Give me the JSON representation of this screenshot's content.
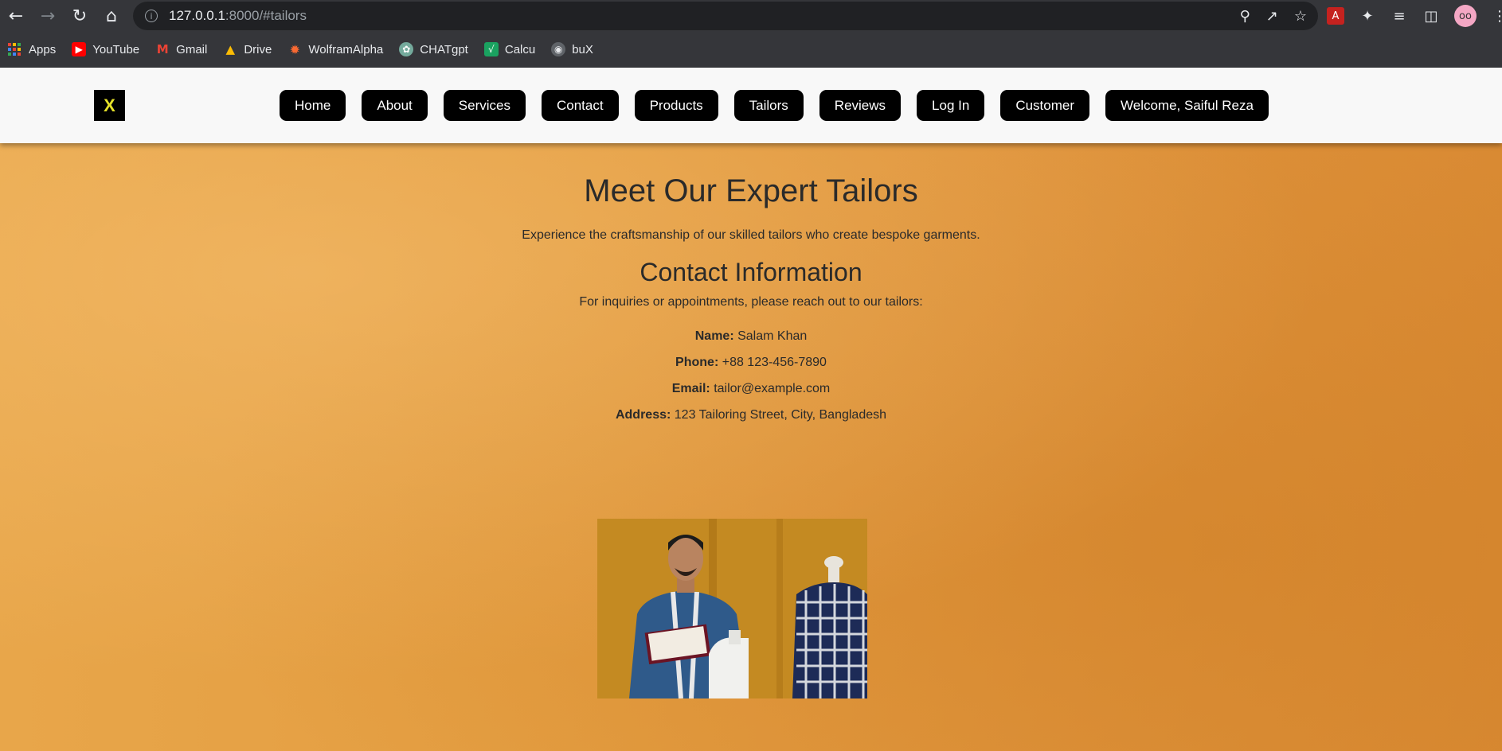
{
  "browser": {
    "url_host": "127.0.0.1",
    "url_rest": ":8000/#tailors",
    "bookmarks": [
      {
        "label": "Apps"
      },
      {
        "label": "YouTube"
      },
      {
        "label": "Gmail"
      },
      {
        "label": "Drive"
      },
      {
        "label": "WolframAlpha"
      },
      {
        "label": "CHATgpt"
      },
      {
        "label": "Calcu"
      },
      {
        "label": "buX"
      }
    ]
  },
  "site": {
    "logo_glyph": "X",
    "nav": [
      {
        "label": "Home"
      },
      {
        "label": "About"
      },
      {
        "label": "Services"
      },
      {
        "label": "Contact"
      },
      {
        "label": "Products"
      },
      {
        "label": "Tailors"
      },
      {
        "label": "Reviews"
      },
      {
        "label": "Log In"
      },
      {
        "label": "Customer"
      },
      {
        "label": "Welcome, Saiful Reza"
      }
    ]
  },
  "content": {
    "title": "Meet Our Expert Tailors",
    "subtitle": "Experience the craftsmanship of our skilled tailors who create bespoke garments.",
    "contact_title": "Contact Information",
    "contact_intro": "For inquiries or appointments, please reach out to our tailors:",
    "contact": {
      "name_label": "Name:",
      "name_value": "Salam Khan",
      "phone_label": "Phone:",
      "phone_value": "+88 123-456-7890",
      "email_label": "Email:",
      "email_value": "tailor@example.com",
      "address_label": "Address:",
      "address_value": "123 Tailoring Street, City, Bangladesh"
    }
  },
  "colors": {
    "background_orange": "#e39c40",
    "nav_button": "#000000",
    "header_bg": "#f8f8f8"
  }
}
